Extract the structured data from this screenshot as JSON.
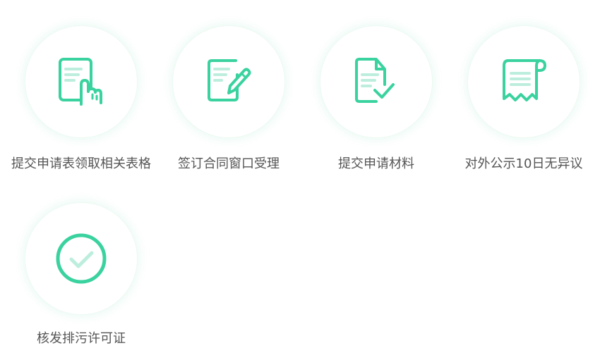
{
  "accent_color": "#3ad29f",
  "accent_light_color": "#bdeedd",
  "steps": [
    {
      "label": "提交申请表领取相关表格",
      "icon": "form-hand-pointer-icon"
    },
    {
      "label": "签订合同窗口受理",
      "icon": "document-pen-icon"
    },
    {
      "label": "提交申请材料",
      "icon": "document-check-icon"
    },
    {
      "label": "对外公示10日无异议",
      "icon": "receipt-scroll-icon"
    },
    {
      "label": "核发排污许可证",
      "icon": "check-circle-icon"
    }
  ]
}
